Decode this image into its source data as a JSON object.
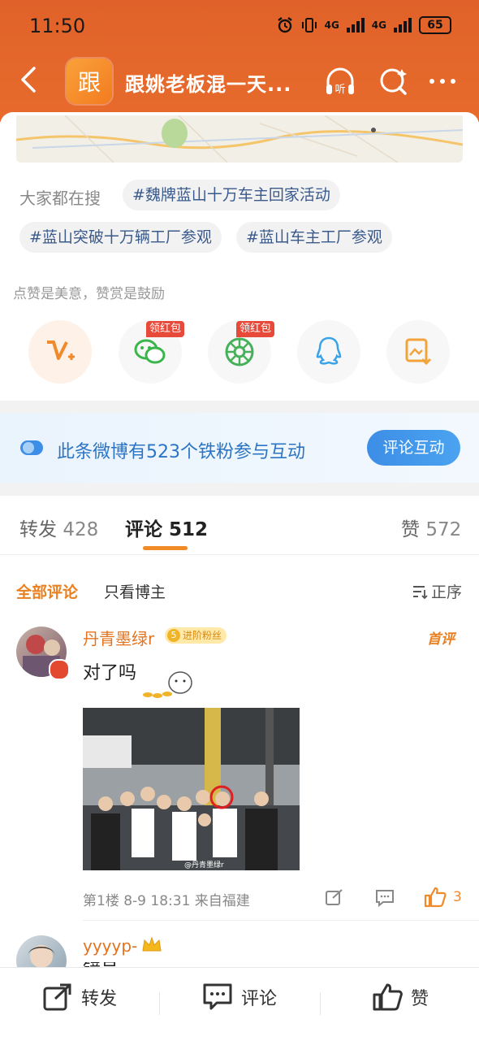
{
  "status": {
    "time": "11:50",
    "network1": "4G",
    "network2": "4G",
    "battery": "65"
  },
  "nav": {
    "logo_char": "跟",
    "title": "跟姚老板混一天..."
  },
  "search": {
    "label": "大家都在搜",
    "tags": [
      "#魏牌蓝山十万车主回家活动",
      "#蓝山突破十万辆工厂参观",
      "#蓝山车主工厂参观"
    ]
  },
  "reward": {
    "note": "点赞是美意，赞赏是鼓励",
    "items": [
      {
        "name": "vip-reward",
        "badge": ""
      },
      {
        "name": "wechat",
        "badge": "领红包"
      },
      {
        "name": "moments",
        "badge": "领红包"
      },
      {
        "name": "qq",
        "badge": ""
      },
      {
        "name": "save-image",
        "badge": ""
      }
    ]
  },
  "fans": {
    "text": "此条微博有523个铁粉参与互动",
    "button": "评论互动"
  },
  "tabs": {
    "repost_label": "转发",
    "repost_count": "428",
    "comment_label": "评论",
    "comment_count": "512",
    "like_label": "赞",
    "like_count": "572"
  },
  "filter": {
    "all": "全部评论",
    "owner_only": "只看博主",
    "sort": "正序"
  },
  "comments": [
    {
      "user": "丹青墨绿r",
      "fan_level": "5",
      "fan_badge": "进阶粉丝",
      "first_tag": "首评",
      "text": "对了吗",
      "image_watermark": "@丹青墨绿r",
      "meta": "第1楼 8-9 18:31 来自福建",
      "likes": "3"
    },
    {
      "user": "yyyyp-",
      "text": "镜号"
    }
  ],
  "bottom": {
    "repost": "转发",
    "comment": "评论",
    "like": "赞"
  },
  "colors": {
    "header": "#e0622a",
    "accent": "#f18b27",
    "link": "#3a5a8c",
    "username": "#e2731f"
  }
}
